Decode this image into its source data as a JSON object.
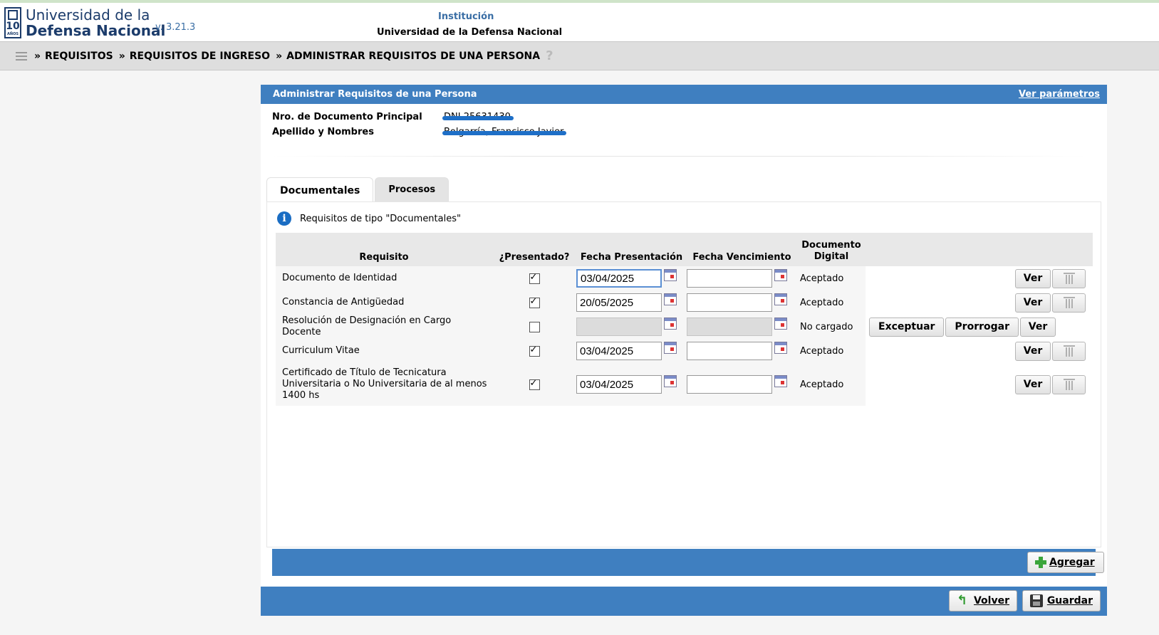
{
  "header": {
    "logo_line1": "Universidad de la",
    "logo_line2": "Defensa Nacional",
    "logo_badge": "10",
    "logo_badge_sub": "AÑOS",
    "version": "v. 3.21.3",
    "institution_label": "Institución",
    "institution_name": "Universidad de la Defensa Nacional"
  },
  "breadcrumb": {
    "items": [
      "REQUISITOS",
      "REQUISITOS DE INGRESO",
      "ADMINISTRAR REQUISITOS DE UNA PERSONA"
    ],
    "separator": "»"
  },
  "panel": {
    "title": "Administrar Requisitos de una Persona",
    "params_link": "Ver parámetros",
    "doc_label": "Nro. de Documento Principal",
    "doc_value": "DNI 25631430",
    "name_label": "Apellido y Nombres",
    "name_value": "Bolgarría, Francisco Javier"
  },
  "tabs": [
    {
      "label": "Documentales",
      "active": true
    },
    {
      "label": "Procesos",
      "active": false
    }
  ],
  "notice": "Requisitos de tipo \"Documentales\"",
  "table": {
    "headers": {
      "requisito": "Requisito",
      "presentado": "¿Presentado?",
      "fecha_presentacion": "Fecha Presentación",
      "fecha_vencimiento": "Fecha Vencimiento",
      "documento_digital_l1": "Documento",
      "documento_digital_l2": "Digital"
    },
    "rows": [
      {
        "requisito": "Documento de Identidad",
        "presentado": true,
        "fecha_presentacion": "03/04/2025",
        "fecha_vencimiento": "",
        "estado": "Aceptado"
      },
      {
        "requisito": "Constancia de Antigüedad",
        "presentado": true,
        "fecha_presentacion": "20/05/2025",
        "fecha_vencimiento": "",
        "estado": "Aceptado"
      },
      {
        "requisito": "Resolución de Designación en Cargo Docente",
        "presentado": false,
        "fecha_presentacion": "",
        "fecha_vencimiento": "",
        "estado": "No cargado"
      },
      {
        "requisito": "Curriculum Vitae",
        "presentado": true,
        "fecha_presentacion": "03/04/2025",
        "fecha_vencimiento": "",
        "estado": "Aceptado"
      },
      {
        "requisito": "Certificado de Título de Tecnicatura Universitaria o No Universitaria de al menos 1400 hs",
        "presentado": true,
        "fecha_presentacion": "03/04/2025",
        "fecha_vencimiento": "",
        "estado": "Aceptado"
      }
    ]
  },
  "buttons": {
    "ver": "Ver",
    "exceptuar": "Exceptuar",
    "prorrogar": "Prorrogar",
    "agregar": "Agregar",
    "volver": "Volver",
    "guardar": "Guardar"
  },
  "colors": {
    "accent_blue": "#3f7fc0",
    "link_blue": "#3a6ea5",
    "logo_navy": "#1c3c6b"
  },
  "icons": [
    "menu-icon",
    "help-icon",
    "info-icon",
    "calendar-icon",
    "trash-icon",
    "plus-icon",
    "back-arrow-icon",
    "save-icon"
  ]
}
